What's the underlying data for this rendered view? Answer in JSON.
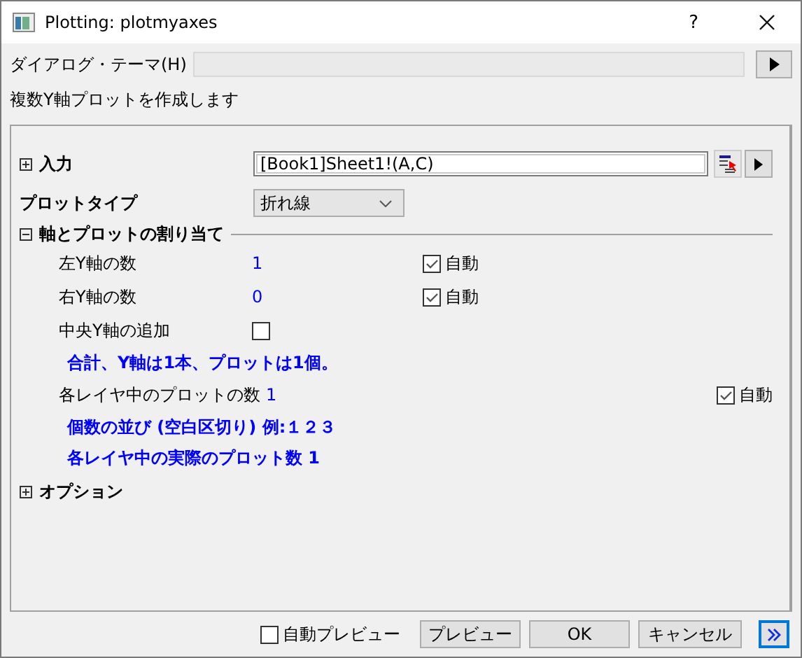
{
  "window": {
    "title": "Plotting: plotmyaxes",
    "help": "?"
  },
  "theme": {
    "label": "ダイアログ・テーマ(H)"
  },
  "description": "複数Y軸プロットを作成します",
  "input": {
    "label": "入力",
    "expanded": false,
    "value": "[Book1]Sheet1!(A,C)"
  },
  "plot_type": {
    "label": "プロットタイプ",
    "value": "折れ線"
  },
  "axes_section": {
    "label": "軸とプロットの割り当て",
    "expanded": true,
    "rows": [
      {
        "kind": "number",
        "label": "左Y軸の数",
        "value": "1",
        "auto": {
          "label": "自動",
          "checked": true
        }
      },
      {
        "kind": "number",
        "label": "右Y軸の数",
        "value": "0",
        "auto": {
          "label": "自動",
          "checked": true
        }
      },
      {
        "kind": "checkbox",
        "label": "中央Y軸の追加",
        "checked": false
      },
      {
        "kind": "note",
        "text": "合計、Y軸は1本、プロットは1個。"
      },
      {
        "kind": "wide",
        "label": "各レイヤ中のプロットの数",
        "value": "1",
        "auto": {
          "label": "自動",
          "checked": true
        }
      },
      {
        "kind": "note",
        "text": "個数の並び (空白区切り) 例:１２３"
      },
      {
        "kind": "note",
        "text": "各レイヤ中の実際のプロット数 1"
      }
    ]
  },
  "options": {
    "label": "オプション",
    "expanded": false
  },
  "footer": {
    "auto_preview": {
      "label": "自動プレビュー",
      "checked": false
    },
    "buttons": [
      "プレビュー",
      "OK",
      "キャンセル"
    ]
  }
}
